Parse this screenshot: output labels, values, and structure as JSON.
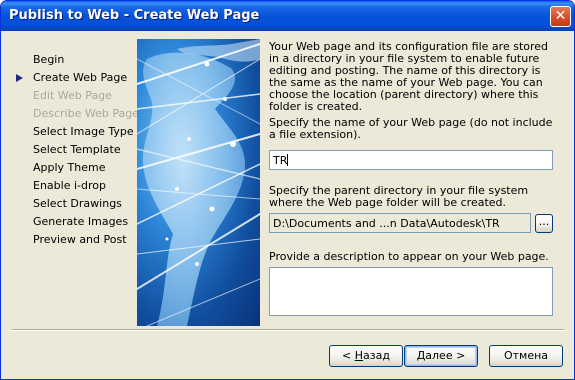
{
  "window": {
    "title": "Publish to Web - Create Web Page",
    "close_glyph": "✕"
  },
  "nav": {
    "current_index": 1,
    "items": [
      {
        "label": "Begin",
        "state": "enabled"
      },
      {
        "label": "Create Web Page",
        "state": "current"
      },
      {
        "label": "Edit Web Page",
        "state": "disabled"
      },
      {
        "label": "Describe Web Page",
        "state": "disabled"
      },
      {
        "label": "Select Image Type",
        "state": "enabled"
      },
      {
        "label": "Select Template",
        "state": "enabled"
      },
      {
        "label": "Apply Theme",
        "state": "enabled"
      },
      {
        "label": "Enable i-drop",
        "state": "enabled"
      },
      {
        "label": "Select Drawings",
        "state": "enabled"
      },
      {
        "label": "Generate Images",
        "state": "enabled"
      },
      {
        "label": "Preview and Post",
        "state": "enabled"
      }
    ]
  },
  "content": {
    "intro": "Your Web page and its configuration file are stored in a directory in your file system to enable future editing and posting.  The name of this directory is the same as the name of your Web page.  You can choose the location (parent directory) where this folder is created.",
    "name_prompt": "Specify the name of your Web page (do not include a file extension).",
    "name_value": "TR",
    "parent_prompt": "Specify the parent directory in your file system where the Web page folder will be created.",
    "parent_value": "D:\\Documents and ...n Data\\Autodesk\\TR",
    "browse_label": "...",
    "description_prompt": "Provide a description to appear on your Web page.",
    "description_value": ""
  },
  "buttons": {
    "back": {
      "prefix": "< ",
      "hotkey": "Н",
      "rest": "азад"
    },
    "next": {
      "hotkey": "Д",
      "rest": "алее >"
    },
    "cancel": "Отмена"
  },
  "colors": {
    "titlebar": "#0653d9",
    "dialog_bg": "#ece9d8",
    "disabled_text": "#aca899",
    "nav_arrow": "#1c2b7e",
    "banner_blue": "#2d86d8"
  }
}
